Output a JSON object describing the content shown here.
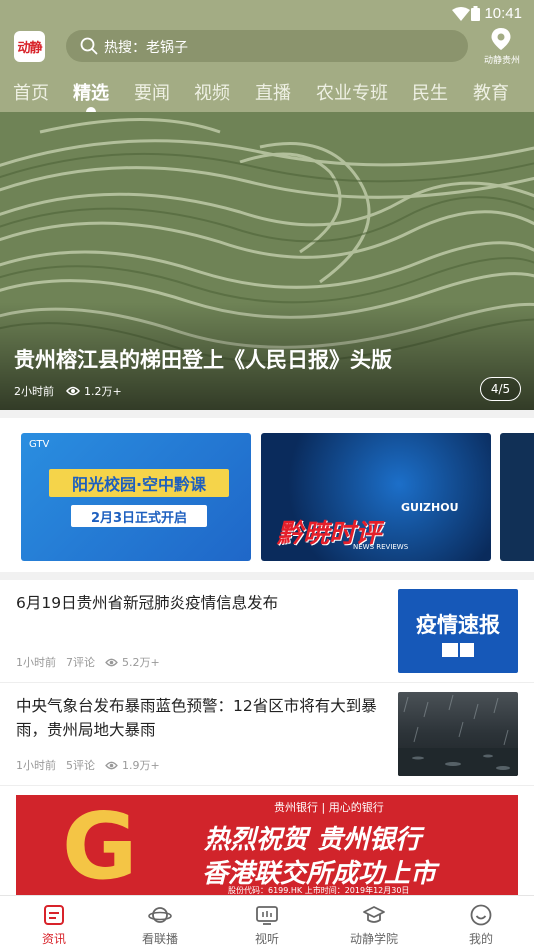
{
  "status": {
    "time": "10:41"
  },
  "header": {
    "logo_text": "动静",
    "search_placeholder": "热搜：老锅子",
    "location_label": "动静贵州"
  },
  "tabs": [
    {
      "label": "首页"
    },
    {
      "label": "精选",
      "active": true
    },
    {
      "label": "要闻"
    },
    {
      "label": "视频"
    },
    {
      "label": "直播"
    },
    {
      "label": "农业专班"
    },
    {
      "label": "民生"
    },
    {
      "label": "教育"
    }
  ],
  "hero": {
    "title": "贵州榕江县的梯田登上《人民日报》头版",
    "time": "2小时前",
    "views": "1.2万+",
    "pager": "4/5"
  },
  "banners": {
    "card1": {
      "brand": "GTV",
      "headline": "阳光校园·空中黔课",
      "sub": "2月3日正式开启"
    },
    "card2": {
      "tag": "GUIZHOU",
      "title": "黔暁时评",
      "sub": "NEWS REVIEWS"
    }
  },
  "news": [
    {
      "title": "6月19日贵州省新冠肺炎疫情信息发布",
      "time": "1小时前",
      "comments": "7评论",
      "views": "5.2万+",
      "thumb_text": "疫情速报"
    },
    {
      "title": "中央气象台发布暴雨蓝色预警：12省区市将有大到暴雨，贵州局地大暴雨",
      "time": "1小时前",
      "comments": "5评论",
      "views": "1.9万+"
    }
  ],
  "ad": {
    "bank": "贵州银行 | 用心的银行",
    "line1": "热烈祝贺  贵州银行",
    "line2": "香港联交所成功上市",
    "line3": "股份代码：6199.HK    上市时间：2019年12月30日"
  },
  "bottom_nav": [
    {
      "label": "资讯",
      "active": true
    },
    {
      "label": "看联播"
    },
    {
      "label": "视听"
    },
    {
      "label": "动静学院"
    },
    {
      "label": "我的"
    }
  ],
  "colors": {
    "header_bg": "#a3ac84",
    "accent": "#d8232a"
  }
}
